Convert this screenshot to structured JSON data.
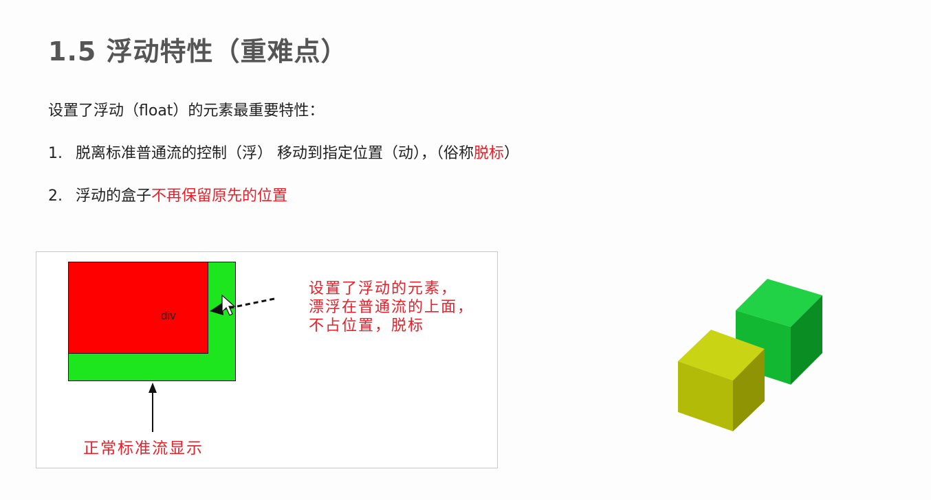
{
  "slide": {
    "title": "1.5 浮动特性（重难点）",
    "intro": "设置了浮动（float）的元素最重要特性：",
    "item1": {
      "number": "1.",
      "text": "脱离标准普通流的控制（浮） 移动到指定位置（动），（俗称",
      "highlight": "脱标",
      "suffix": "）"
    },
    "item2": {
      "number": "2.",
      "text": "浮动的盒子",
      "highlight": "不再保留原先的位置"
    }
  },
  "figure": {
    "div_label": "div",
    "annotation_lines": [
      "设置了浮动的元素，",
      "漂浮在普通流的上面，",
      "不占位置，脱标"
    ],
    "normal_flow_label": "正常标准流显示"
  },
  "colors": {
    "title": "#555555",
    "text": "#222222",
    "highlight": "#e8202a",
    "float_box": "#ff0000",
    "normal_box": "#1ee61e",
    "cube_green": "#1cc43c",
    "cube_yellow": "#b4c20a"
  }
}
